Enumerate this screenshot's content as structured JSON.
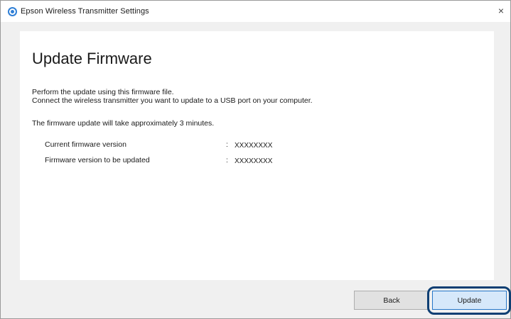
{
  "window": {
    "title": "Epson Wireless Transmitter Settings",
    "close_glyph": "×",
    "icon": "epson-app-icon"
  },
  "page": {
    "heading": "Update Firmware",
    "description_line1": "Perform the update using this firmware file.",
    "description_line2": "Connect the wireless transmitter you want to update to a USB port on your computer.",
    "duration_note": "The firmware update will take approximately 3 minutes.",
    "info_rows": [
      {
        "label": "Current firmware version",
        "separator": ":",
        "value": "XXXXXXXX"
      },
      {
        "label": "Firmware version to be updated",
        "separator": ":",
        "value": "XXXXXXXX"
      }
    ]
  },
  "buttons": {
    "back_label": "Back",
    "update_label": "Update"
  },
  "colors": {
    "accent": "#2677c9",
    "focus_ring": "#0f3f73",
    "update_button_bg": "#d6e8fa"
  }
}
